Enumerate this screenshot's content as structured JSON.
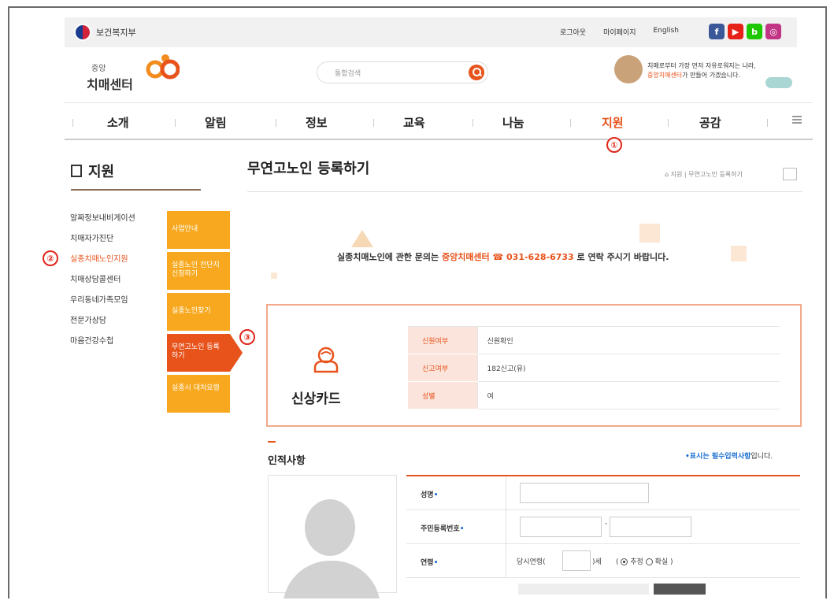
{
  "util": {
    "gov_name": "보건복지부",
    "links": [
      "로그아웃",
      "마이페이지",
      "English"
    ],
    "sns": [
      {
        "icon": "facebook-icon",
        "glyph": "f",
        "color": "#3b5998"
      },
      {
        "icon": "youtube-icon",
        "glyph": "▶",
        "color": "#e62117"
      },
      {
        "icon": "blog-icon",
        "glyph": "b",
        "color": "#1ec800"
      },
      {
        "icon": "instagram-icon",
        "glyph": "◎",
        "color": "#c13584"
      }
    ]
  },
  "header": {
    "logo_small": "중앙",
    "logo_name": "치매센터",
    "search_placeholder": "통합검색",
    "promo_line1": "치매로부터 가장 먼저 자유로워지는 나라,",
    "promo_hl": "중앙치매센터",
    "promo_line2": "가 만들어 가겠습니다."
  },
  "gnb": [
    "소개",
    "알림",
    "정보",
    "교육",
    "나눔",
    "지원",
    "공감"
  ],
  "gnb_active": "지원",
  "markers": [
    "①",
    "②",
    "③"
  ],
  "lnb": {
    "title": "지원",
    "items": [
      "알짜정보내비게이션",
      "치매자가진단",
      "실종치매노인지원",
      "치매상담콜센터",
      "우리동네가족모임",
      "전문가상담",
      "마음건강수첩"
    ],
    "active": "실종치매노인지원"
  },
  "subtabs": [
    "사업안내",
    "실종노인 전단지 신청하기",
    "실종노인찾기",
    "무연고노인 등록하기",
    "실종시 대처요령"
  ],
  "subtab_active": "무연고노인 등록하기",
  "content": {
    "title": "무연고노인 등록하기",
    "breadcrumb": "⌂ 지원  |  무연고노인 등록하기",
    "notice_pre": "실종치매노인에 관한 문의는",
    "notice_hl": "중앙치매센터 ☎ 031-628-6733",
    "notice_post": "로 연락 주시기 바랍니다."
  },
  "card": {
    "name": "신상카드",
    "rows": [
      {
        "k": "신원여부",
        "v": "신원확인"
      },
      {
        "k": "신고여부",
        "v": "182신고(유)"
      },
      {
        "k": "성별",
        "v": "여"
      }
    ]
  },
  "form": {
    "section_title": "인적사항",
    "req_note_hl": "•표시는 필수입력사항",
    "req_note_tail": "입니다.",
    "labels": {
      "name": "성명",
      "rrn": "주민등록번호",
      "age": "연령"
    },
    "required_mark": "•",
    "rrn_sep": "-",
    "age_prefix": "당시연령(",
    "age_suffix": ")세",
    "age_paren_open": "(",
    "age_est": "추정",
    "age_sure": "확실",
    "age_paren_close": ")",
    "age_selected": "추정"
  },
  "colors": {
    "accent": "#e8531c",
    "tab": "#f7a81e",
    "marker": "#e0261b"
  }
}
